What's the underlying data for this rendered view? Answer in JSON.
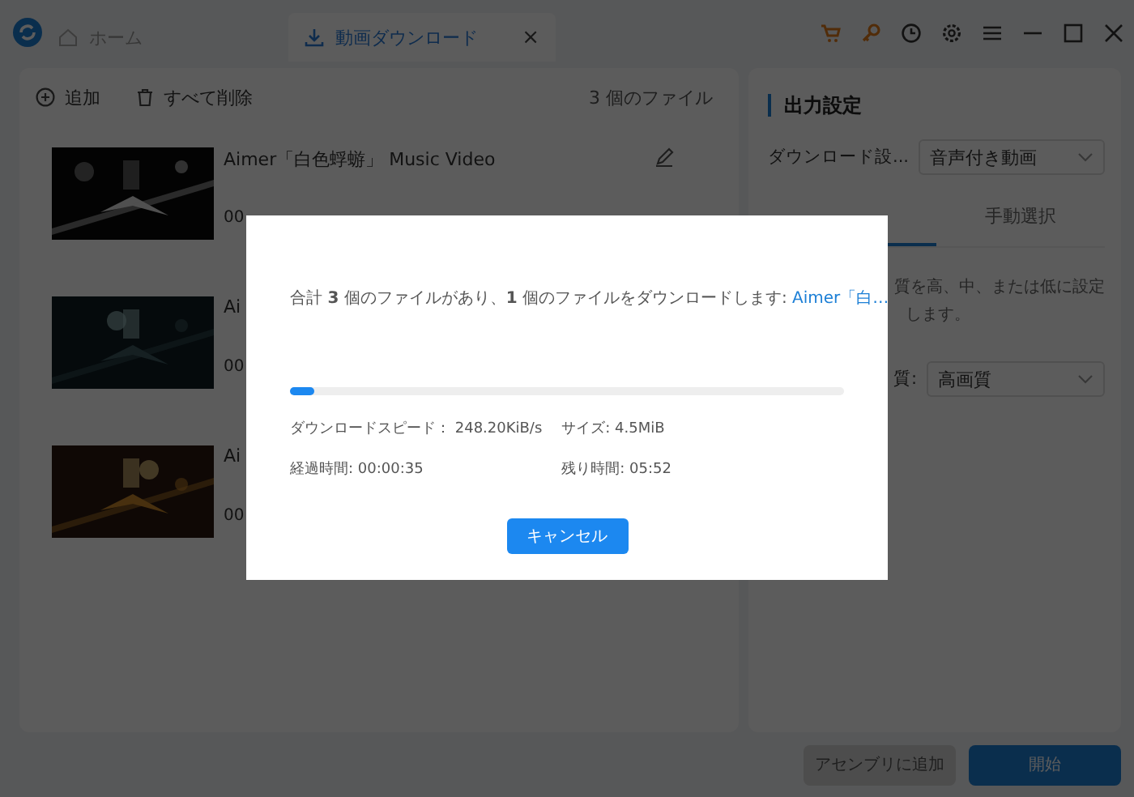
{
  "window": {
    "tabs": [
      {
        "label": "ホーム",
        "selected": false
      },
      {
        "label": "動画ダウンロード",
        "selected": true,
        "close": "×"
      }
    ]
  },
  "toolbar": {
    "add": "追加",
    "delete_all": "すべて削除",
    "file_count": "3 個のファイル"
  },
  "videos": [
    {
      "title": "Aimer「白色蜉蝣」 Music Video",
      "duration": "00"
    },
    {
      "title": "Ai",
      "duration": "00"
    },
    {
      "title": "Ai",
      "duration": "00"
    }
  ],
  "output_settings": {
    "heading": "出力設定",
    "download_setting": {
      "label": "ダウンロード設...",
      "value": "音声付き動画"
    },
    "tabs": [
      {
        "selected": true
      },
      {
        "label": "手動選択",
        "selected": false
      }
    ],
    "description_lines": [
      "質を高、中、または低に設定",
      "します。"
    ],
    "quality": {
      "label": "質:",
      "value": "高画質"
    }
  },
  "actions": [
    {
      "label": "アセンブリに追加",
      "disabled": true
    },
    {
      "label": "開始",
      "disabled": false
    }
  ],
  "dialog": {
    "message": "合計 **3** 個のファイルがあり、**1** 個のファイルをダウンロードします: ",
    "message_link": "Aimer「白…",
    "progress": {
      "level": 0.045
    },
    "speed": "ダウンロードスピード： 248.20KiB/s",
    "size": "サイズ: 4.5MiB",
    "elapsed": "経過時間: 00:00:35",
    "remaining": "残り時間: 05:52",
    "cancel": "キャンセル"
  }
}
